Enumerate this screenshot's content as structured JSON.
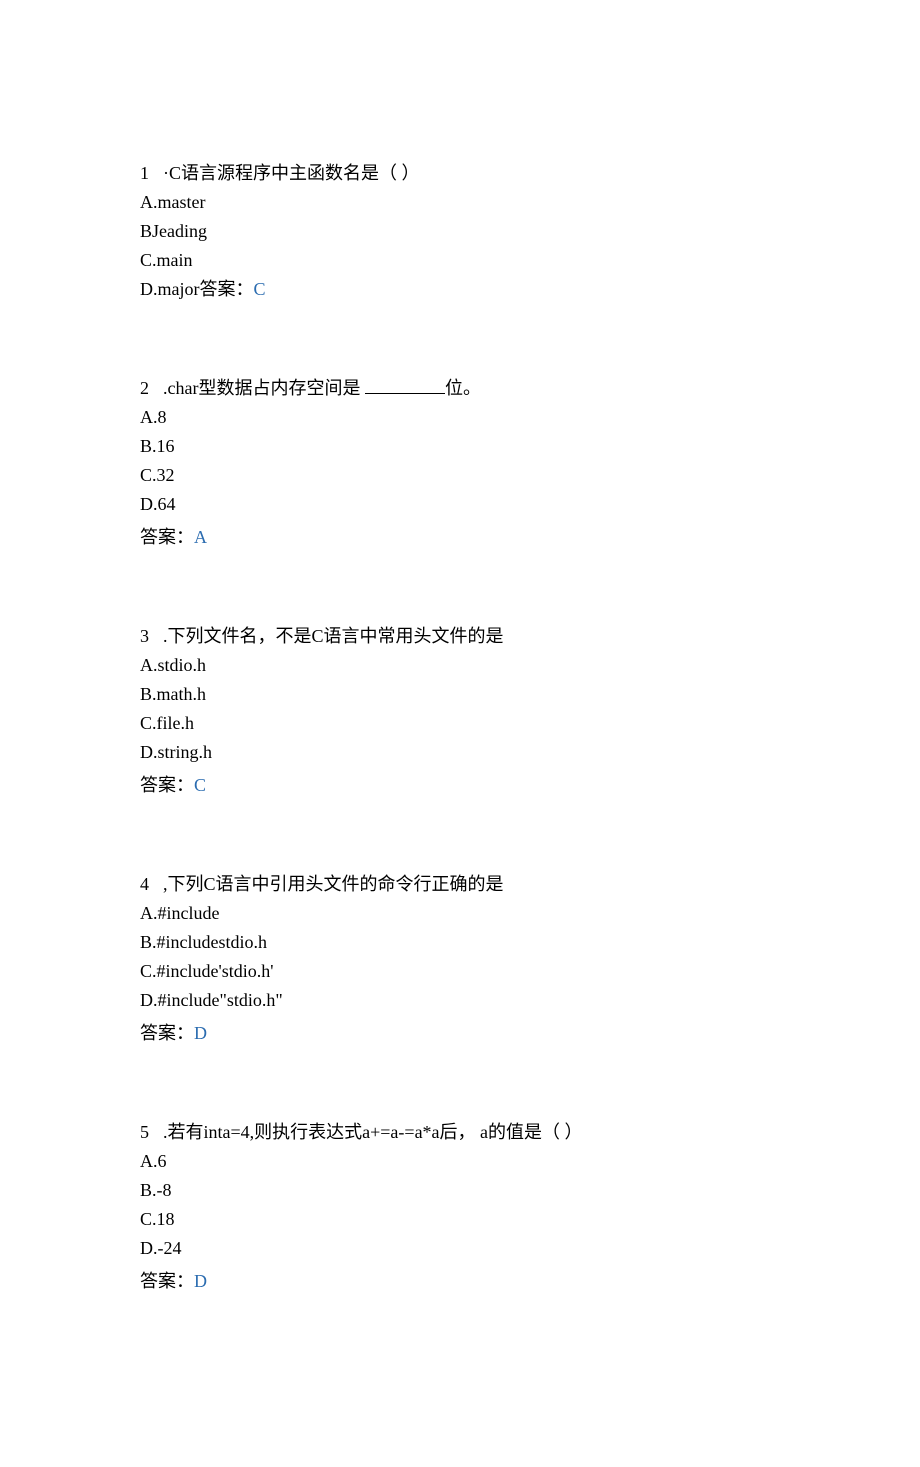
{
  "questions": [
    {
      "number": "1",
      "number_sep": "·",
      "text": "C语言源程序中主函数名是（ ）",
      "options": [
        "A.master",
        "BJeading",
        "C.main",
        "D.major"
      ],
      "answer_label": "答案：",
      "answer_value": "C",
      "answer_inline_with_last": true
    },
    {
      "number": "2",
      "number_sep": ".",
      "text_before_blank": "char型数据占内存空间是 ",
      "text_after_blank": "位。",
      "has_blank": true,
      "options": [
        "A.8",
        "B.16",
        "C.32",
        "D.64"
      ],
      "answer_label": "答案：",
      "answer_value": "A",
      "answer_inline_with_last": false
    },
    {
      "number": "3",
      "number_sep": ".",
      "text": "下列文件名，不是C语言中常用头文件的是",
      "options": [
        "A.stdio.h",
        "B.math.h",
        "C.file.h",
        "D.string.h"
      ],
      "answer_label": "答案：",
      "answer_value": "C",
      "answer_inline_with_last": false
    },
    {
      "number": "4",
      "number_sep": ",",
      "text": "下列C语言中引用头文件的命令行正确的是",
      "options": [
        "A.#include",
        "B.#includestdio.h",
        "C.#include'stdio.h'",
        "D.#include\"stdio.h\""
      ],
      "answer_label": "答案：",
      "answer_value": "D",
      "answer_inline_with_last": false
    },
    {
      "number": "5",
      "number_sep": ".",
      "text": "若有inta=4,则执行表达式a+=a-=a*a后， a的值是（ ）",
      "options": [
        "A.6",
        "B.-8",
        "C.18",
        "D.-24"
      ],
      "answer_label": "答案：",
      "answer_value": "D",
      "answer_inline_with_last": false
    }
  ]
}
